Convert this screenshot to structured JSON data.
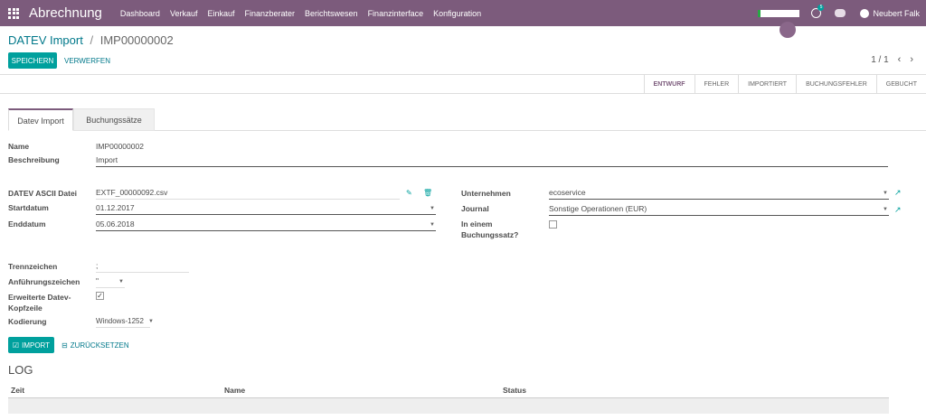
{
  "navbar": {
    "brand": "Abrechnung",
    "menu": [
      "Dashboard",
      "Verkauf",
      "Einkauf",
      "Finanzberater",
      "Berichtswesen",
      "Finanzinterface",
      "Konfiguration"
    ],
    "activity_count": "5",
    "user": "Neubert Falk"
  },
  "breadcrumb": {
    "parent": "DATEV Import",
    "separator": "/",
    "current": "IMP00000002"
  },
  "buttons": {
    "save": "SPEICHERN",
    "discard": "VERWERFEN",
    "import": "IMPORT",
    "reset": "ZURÜCKSETZEN"
  },
  "pager": {
    "value": "1 / 1",
    "prev": "‹",
    "next": "›"
  },
  "status": {
    "steps": [
      "ENTWURF",
      "FEHLER",
      "IMPORTIERT",
      "BUCHUNGSFEHLER",
      "GEBUCHT"
    ],
    "active": "ENTWURF"
  },
  "tabs": [
    "Datev Import",
    "Buchungssätze"
  ],
  "form": {
    "name_label": "Name",
    "name_value": "IMP00000002",
    "beschreibung_label": "Beschreibung",
    "beschreibung_value": "Import",
    "datei_label": "DATEV ASCII Datei",
    "datei_value": "EXTF_00000092.csv",
    "startdatum_label": "Startdatum",
    "startdatum_value": "01.12.2017",
    "enddatum_label": "Enddatum",
    "enddatum_value": "05.06.2018",
    "unternehmen_label": "Unternehmen",
    "unternehmen_value": "ecoservice",
    "journal_label": "Journal",
    "journal_value": "Sonstige Operationen (EUR)",
    "buchungssatz_label_1": "In einem",
    "buchungssatz_label_2": "Buchungssatz?",
    "trennzeichen_label": "Trennzeichen",
    "trennzeichen_value": ";",
    "anfuehrungszeichen_label": "Anführungszeichen",
    "anfuehrungszeichen_value": "\"",
    "erweiterte_label_1": "Erweiterte Datev-",
    "erweiterte_label_2": "Kopfzeile",
    "kodierung_label": "Kodierung",
    "kodierung_value": "Windows-1252"
  },
  "log": {
    "title": "LOG",
    "columns": [
      "Zeit",
      "Name",
      "Status"
    ]
  },
  "colors": {
    "navbar": "#7c5b7c",
    "primary": "#00a09d",
    "link": "#00788a"
  }
}
